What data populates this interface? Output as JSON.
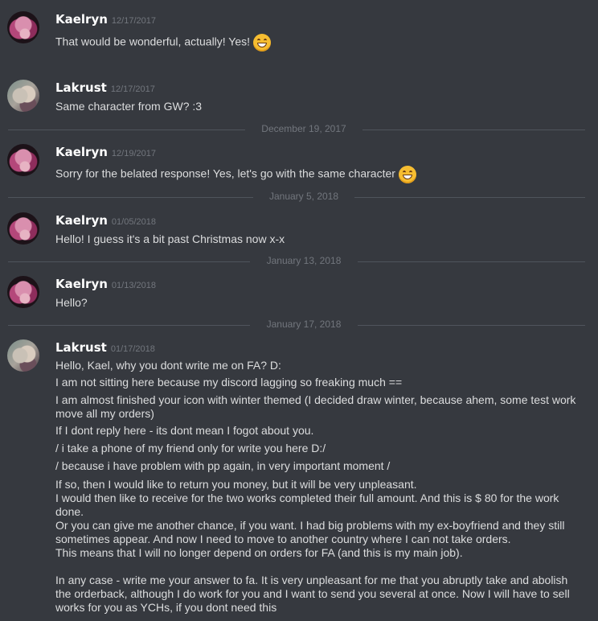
{
  "messages": [
    {
      "author": "Kaelryn",
      "timestamp": "12/17/2017",
      "lines": [
        "That would be wonderful, actually! Yes!"
      ],
      "emoji": "grinning-face-emoji"
    },
    {
      "author": "Lakrust",
      "timestamp": "12/17/2017",
      "lines": [
        "Same character from GW? :3"
      ]
    },
    {
      "author": "Kaelryn",
      "timestamp": "12/19/2017",
      "lines": [
        "Sorry for the belated response! Yes, let's go with the same character"
      ],
      "emoji": "grinning-face-emoji"
    },
    {
      "author": "Kaelryn",
      "timestamp": "01/05/2018",
      "lines": [
        "Hello! I guess it's a bit past Christmas now x-x"
      ]
    },
    {
      "author": "Kaelryn",
      "timestamp": "01/13/2018",
      "lines": [
        "Hello?"
      ]
    },
    {
      "author": "Lakrust",
      "timestamp": "01/17/2018",
      "lines": [
        "Hello, Kael, why you dont write me on FA? D:",
        "I am not sitting here because my discord lagging so freaking much ==",
        "I am almost finished your icon with winter themed (I decided draw winter, because ahem, some test work move all my orders)",
        "If I dont reply here - its dont mean I fogot about you.",
        "/ i take a phone of my friend only for write you here D:/",
        "/ because i have problem with pp again, in very important moment /",
        "If so, then I would like to return you money, but it will be very unpleasant.\nI would then like to receive for the two works completed their full amount. And this is $ 80 for the work done.\nOr you can give me another chance, if you want. I had big problems with my ex-boyfriend and they still sometimes appear. And now I need to move to another country where I can not take orders.\nThis means that I will no longer depend on orders for FA (and this is my main job).\n\nIn any case - write me your answer to fa. It is very unpleasant for me that you abruptly take and abolish the orderback, although I do work for you and I want to send you several at once. Now I will have to sell works for you as YCHs, if you dont need this"
      ]
    }
  ],
  "dividers": [
    "December 19, 2017",
    "January 5, 2018",
    "January 13, 2018",
    "January 17, 2018"
  ],
  "colors": {
    "background": "#36393f",
    "author": "#ffffff",
    "timestamp": "#72767d",
    "text": "#dcddde",
    "divider_line": "#4f545c"
  }
}
